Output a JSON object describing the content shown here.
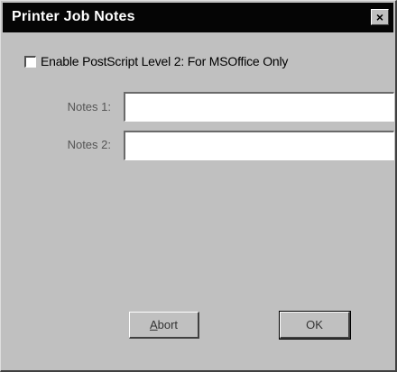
{
  "window": {
    "title": "Printer Job Notes",
    "close_label": "×"
  },
  "options": {
    "postscript_checkbox_label": "Enable PostScript Level 2: For MSOffice Only",
    "postscript_checked": false
  },
  "fields": {
    "notes1_label": "Notes 1:",
    "notes1_value": "",
    "notes2_label": "Notes 2:",
    "notes2_value": ""
  },
  "buttons": {
    "abort_mnemonic": "A",
    "abort_rest": "bort",
    "ok_label": "OK"
  },
  "icons": {
    "close": "close-icon",
    "checkbox": "checkbox-icon"
  }
}
